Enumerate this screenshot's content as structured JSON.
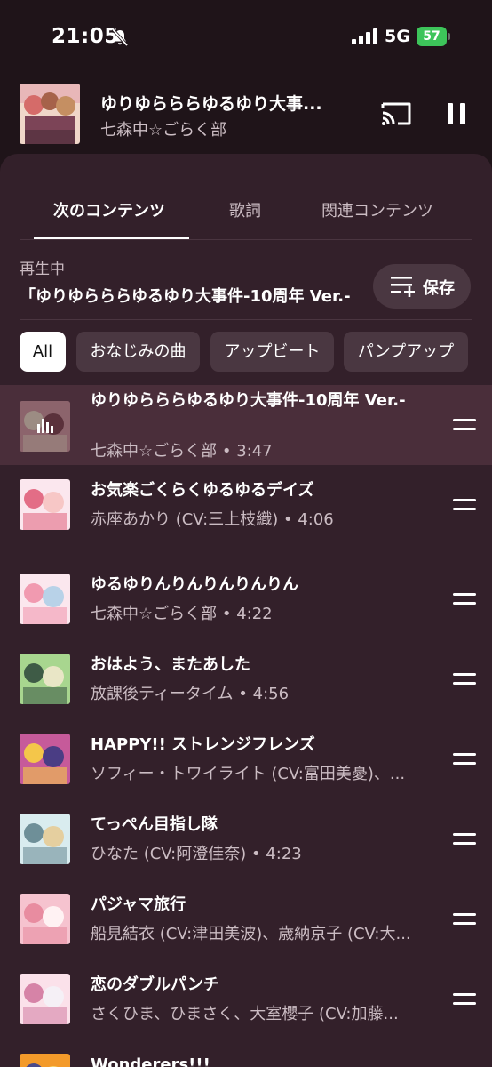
{
  "status": {
    "time": "21:05",
    "network": "5G",
    "battery": "57"
  },
  "mini_player": {
    "title": "ゆりゆらららゆるゆり大事...",
    "artist": "七森中☆ごらく部"
  },
  "tabs": [
    {
      "label": "次のコンテンツ"
    },
    {
      "label": "歌詞"
    },
    {
      "label": "関連コンテンツ"
    }
  ],
  "now_playing": {
    "label": "再生中",
    "title": "「ゆりゆらららゆるゆり大事件-10周年 Ver.-"
  },
  "save_label": "保存",
  "chips": [
    {
      "label": "All"
    },
    {
      "label": "おなじみの曲"
    },
    {
      "label": "アップビート"
    },
    {
      "label": "パンプアップ"
    }
  ],
  "queue": [
    {
      "title": "ゆりゆらららゆるゆり大事件-10周年 Ver.-",
      "subtitle": "七森中☆ごらく部 • 3:47",
      "art_colors": [
        "#d89aa6",
        "#f0d7c9",
        "#8a4c5b"
      ]
    },
    {
      "title": "お気楽ごくらくゆるゆるデイズ",
      "subtitle": "赤座あかり (CV:三上枝織) • 4:06",
      "art_colors": [
        "#fbe7ee",
        "#e36d86",
        "#f7c7c6"
      ]
    },
    {
      "title": "ゆるゆりんりんりんりんりん",
      "subtitle": "七森中☆ごらく部 • 4:22",
      "art_colors": [
        "#fbe7ee",
        "#f19ab0",
        "#b8d2e8"
      ]
    },
    {
      "title": "おはよう、またあした",
      "subtitle": "放課後ティータイム • 4:56",
      "art_colors": [
        "#a8d68f",
        "#3e5b46",
        "#e9e6c6"
      ]
    },
    {
      "title": "HAPPY!! ストレンジフレンズ",
      "subtitle": "ソフィー・トワイライト (CV:富田美憂)、...",
      "art_colors": [
        "#c65a9a",
        "#f4c64a",
        "#4a3d84"
      ]
    },
    {
      "title": "てっぺん目指し隊",
      "subtitle": "ひなた (CV:阿澄佳奈) • 4:23",
      "art_colors": [
        "#d9ecef",
        "#6e8f98",
        "#e5cf9f"
      ]
    },
    {
      "title": "パジャマ旅行",
      "subtitle": "船見結衣 (CV:津田美波)、歳納京子 (CV:大...",
      "art_colors": [
        "#f6c3cf",
        "#e88ca0",
        "#fff2f3"
      ]
    },
    {
      "title": "恋のダブルパンチ",
      "subtitle": "さくひま、ひまさく、大室櫻子 (CV:加藤...",
      "art_colors": [
        "#fbe1ea",
        "#d683a7",
        "#f5f0f6"
      ]
    },
    {
      "title": "Wonderers!!!",
      "subtitle": "",
      "art_colors": [
        "#f39a2a",
        "#4a4a8a",
        "#f8d36a"
      ]
    }
  ]
}
